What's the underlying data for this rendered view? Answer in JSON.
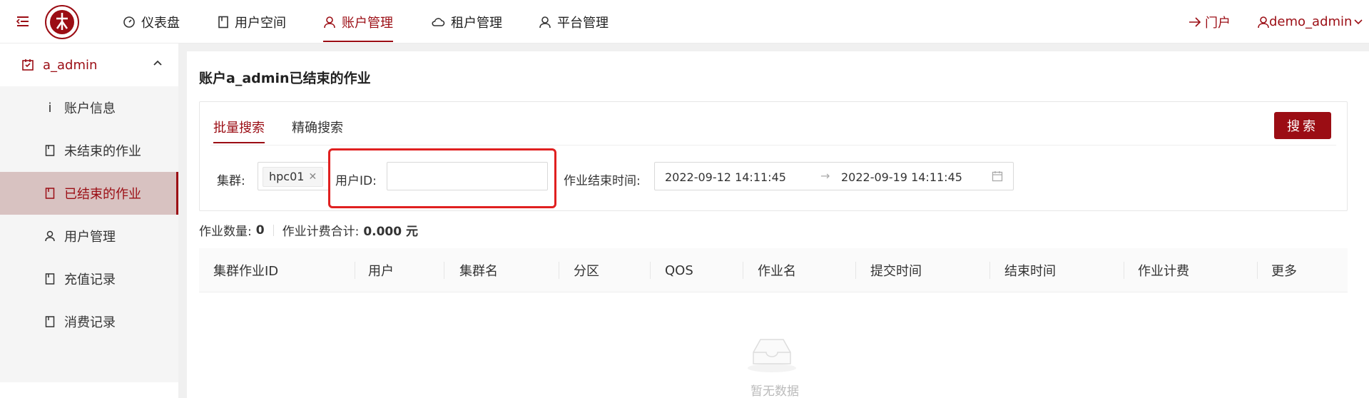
{
  "colors": {
    "accent": "#9b0d14",
    "highlight": "#e02020"
  },
  "header": {
    "nav": [
      {
        "label": "仪表盘",
        "icon": "dashboard-icon"
      },
      {
        "label": "用户空间",
        "icon": "book-icon"
      },
      {
        "label": "账户管理",
        "icon": "user-icon",
        "active": true
      },
      {
        "label": "租户管理",
        "icon": "cloud-icon"
      },
      {
        "label": "平台管理",
        "icon": "user-icon"
      }
    ],
    "portal_label": "门户",
    "user_label": "demo_admin"
  },
  "sidebar": {
    "group_label": "a_admin",
    "items": [
      {
        "label": "账户信息",
        "icon": "info-icon"
      },
      {
        "label": "未结束的作业",
        "icon": "book-icon"
      },
      {
        "label": "已结束的作业",
        "icon": "book-icon",
        "active": true
      },
      {
        "label": "用户管理",
        "icon": "user-icon"
      },
      {
        "label": "充值记录",
        "icon": "book-icon"
      },
      {
        "label": "消费记录",
        "icon": "book-icon"
      }
    ]
  },
  "main": {
    "title": "账户a_admin已结束的作业",
    "tabs": [
      "批量搜索",
      "精确搜索"
    ],
    "search_button": "搜索",
    "filters": {
      "cluster_label": "集群:",
      "cluster_tag": "hpc01",
      "user_id_label": "用户ID:",
      "user_id_value": "",
      "end_time_label": "作业结束时间:",
      "start_date": "2022-09-12 14:11:45",
      "end_date": "2022-09-19 14:11:45"
    },
    "stats": {
      "count_label": "作业数量:",
      "count_value": "0",
      "fee_label": "作业计费合计:",
      "fee_value": "0.000 元"
    },
    "table": {
      "columns": [
        "集群作业ID",
        "用户",
        "集群名",
        "分区",
        "QOS",
        "作业名",
        "提交时间",
        "结束时间",
        "作业计费",
        "更多"
      ]
    },
    "empty_text": "暂无数据"
  }
}
